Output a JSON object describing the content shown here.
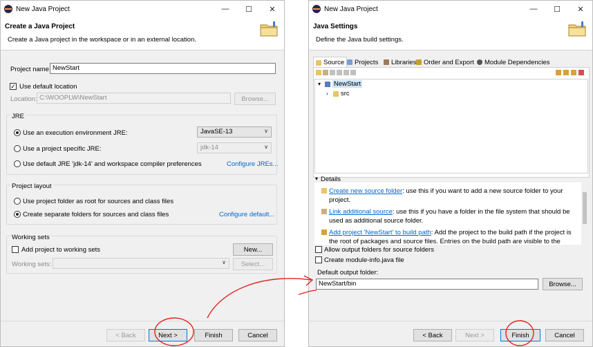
{
  "left": {
    "window_title": "New Java Project",
    "banner_title": "Create a Java Project",
    "banner_desc": "Create a Java project in the workspace or in an external location.",
    "project_name_label": "Project name:",
    "project_name_value": "NewStart",
    "use_default_location": "Use default location",
    "location_label": "Location:",
    "location_value": "C:\\WOOPLW\\NewStart",
    "browse": "Browse...",
    "jre_group": "JRE",
    "jre_opt1": "Use an execution environment JRE:",
    "jre_opt1_value": "JavaSE-13",
    "jre_opt2": "Use a project specific JRE:",
    "jre_opt2_value": "jdk-14",
    "jre_opt3": "Use default JRE 'jdk-14' and workspace compiler preferences",
    "configure_jres": "Configure JREs...",
    "layout_group": "Project layout",
    "layout_opt1": "Use project folder as root for sources and class files",
    "layout_opt2": "Create separate folders for sources and class files",
    "configure_default": "Configure default...",
    "ws_group": "Working sets",
    "ws_add": "Add project to working sets",
    "ws_new": "New...",
    "ws_label": "Working sets:",
    "ws_select": "Select...",
    "back": "< Back",
    "next": "Next >",
    "finish": "Finish",
    "cancel": "Cancel"
  },
  "right": {
    "window_title": "New Java Project",
    "banner_title": "Java Settings",
    "banner_desc": "Define the Java build settings.",
    "tabs": [
      "Source",
      "Projects",
      "Libraries",
      "Order and Export",
      "Module Dependencies"
    ],
    "tree_root": "NewStart",
    "tree_child": "src",
    "details_label": "Details",
    "d1_link": "Create new source folder",
    "d1_text": ": use this if you want to add a new source folder to your",
    "d1_text2": "project.",
    "d2_link": "Link additional source",
    "d2_text": ": use this if you have a folder in the file system that should be",
    "d2_text2": "used as additional source folder.",
    "d3_link": "Add project 'NewStart' to build path",
    "d3_text": ": Add the project to the build path if the project is",
    "d3_text2": "the root of packages and source files. Entries on the build path are visible to the",
    "allow_output": "Allow output folders for source folders",
    "create_module_info": "Create module-info.java file",
    "default_output_label": "Default output folder:",
    "default_output_value": "NewStart/bin",
    "browse": "Browse...",
    "back": "< Back",
    "next": "Next >",
    "finish": "Finish",
    "cancel": "Cancel"
  },
  "icons": [
    "eclipse-icon",
    "folder-wizard-icon",
    "minimize-icon",
    "maximize-icon",
    "close-icon"
  ],
  "colors": {
    "link": "#0066cc",
    "annotation": "#e02020",
    "default_button_border": "#0078d7"
  }
}
